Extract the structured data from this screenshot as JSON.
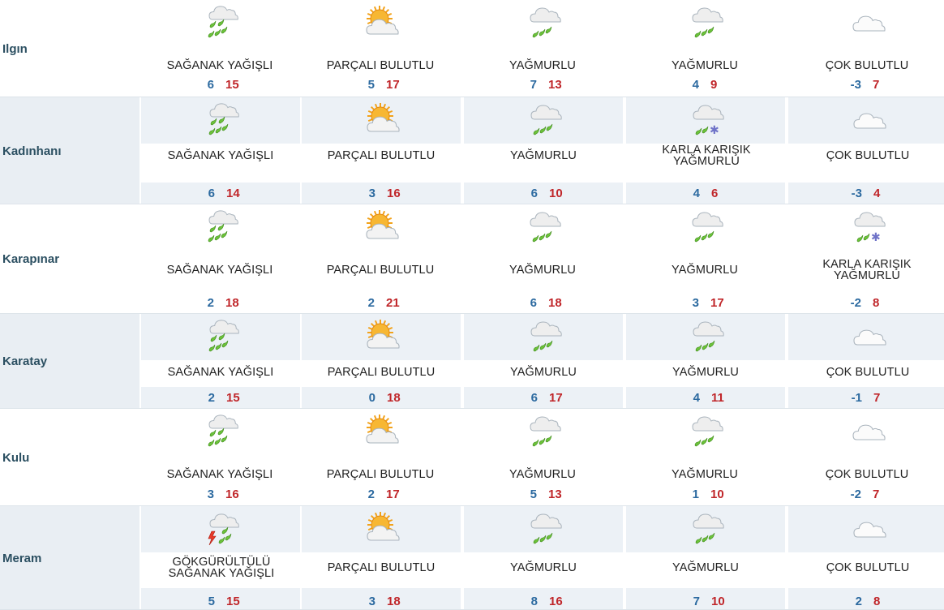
{
  "colors": {
    "min_temp": "#2c6aa0",
    "max_temp": "#c0262a",
    "city": "#2b4f61",
    "alt_row_bg": "#ecf1f6"
  },
  "rows": [
    {
      "city": "Ilgın",
      "days": [
        {
          "icon": "heavy-rain-icon",
          "cond": "SAĞANAK YAĞIŞLI",
          "min": "6",
          "max": "15"
        },
        {
          "icon": "partly-cloudy-icon",
          "cond": "PARÇALI BULUTLU",
          "min": "5",
          "max": "17"
        },
        {
          "icon": "rain-icon",
          "cond": "YAĞMURLU",
          "min": "7",
          "max": "13"
        },
        {
          "icon": "rain-icon",
          "cond": "YAĞMURLU",
          "min": "4",
          "max": "9"
        },
        {
          "icon": "overcast-icon",
          "cond": "ÇOK BULUTLU",
          "min": "-3",
          "max": "7"
        }
      ]
    },
    {
      "city": "Kadınhanı",
      "days": [
        {
          "icon": "heavy-rain-icon",
          "cond": "SAĞANAK YAĞIŞLI",
          "min": "6",
          "max": "14"
        },
        {
          "icon": "partly-cloudy-icon",
          "cond": "PARÇALI BULUTLU",
          "min": "3",
          "max": "16"
        },
        {
          "icon": "rain-icon",
          "cond": "YAĞMURLU",
          "min": "6",
          "max": "10"
        },
        {
          "icon": "sleet-icon",
          "cond": "KARLA KARIŞIK YAĞMURLU",
          "min": "4",
          "max": "6"
        },
        {
          "icon": "overcast-icon",
          "cond": "ÇOK BULUTLU",
          "min": "-3",
          "max": "4"
        }
      ]
    },
    {
      "city": "Karapınar",
      "days": [
        {
          "icon": "heavy-rain-icon",
          "cond": "SAĞANAK YAĞIŞLI",
          "min": "2",
          "max": "18"
        },
        {
          "icon": "partly-cloudy-icon",
          "cond": "PARÇALI BULUTLU",
          "min": "2",
          "max": "21"
        },
        {
          "icon": "rain-icon",
          "cond": "YAĞMURLU",
          "min": "6",
          "max": "18"
        },
        {
          "icon": "rain-icon",
          "cond": "YAĞMURLU",
          "min": "3",
          "max": "17"
        },
        {
          "icon": "sleet-icon",
          "cond": "KARLA KARIŞIK YAĞMURLU",
          "min": "-2",
          "max": "8"
        }
      ]
    },
    {
      "city": "Karatay",
      "days": [
        {
          "icon": "heavy-rain-icon",
          "cond": "SAĞANAK YAĞIŞLI",
          "min": "2",
          "max": "15"
        },
        {
          "icon": "partly-cloudy-icon",
          "cond": "PARÇALI BULUTLU",
          "min": "0",
          "max": "18"
        },
        {
          "icon": "rain-icon",
          "cond": "YAĞMURLU",
          "min": "6",
          "max": "17"
        },
        {
          "icon": "rain-icon",
          "cond": "YAĞMURLU",
          "min": "4",
          "max": "11"
        },
        {
          "icon": "overcast-icon",
          "cond": "ÇOK BULUTLU",
          "min": "-1",
          "max": "7"
        }
      ]
    },
    {
      "city": "Kulu",
      "days": [
        {
          "icon": "heavy-rain-icon",
          "cond": "SAĞANAK YAĞIŞLI",
          "min": "3",
          "max": "16"
        },
        {
          "icon": "partly-cloudy-icon",
          "cond": "PARÇALI BULUTLU",
          "min": "2",
          "max": "17"
        },
        {
          "icon": "rain-icon",
          "cond": "YAĞMURLU",
          "min": "5",
          "max": "13"
        },
        {
          "icon": "rain-icon",
          "cond": "YAĞMURLU",
          "min": "1",
          "max": "10"
        },
        {
          "icon": "overcast-icon",
          "cond": "ÇOK BULUTLU",
          "min": "-2",
          "max": "7"
        }
      ]
    },
    {
      "city": "Meram",
      "days": [
        {
          "icon": "thunderstorm-icon",
          "cond": "GÖKGÜRÜLTÜLÜ SAĞANAK YAĞIŞLI",
          "min": "5",
          "max": "15"
        },
        {
          "icon": "partly-cloudy-icon",
          "cond": "PARÇALI BULUTLU",
          "min": "3",
          "max": "18"
        },
        {
          "icon": "rain-icon",
          "cond": "YAĞMURLU",
          "min": "8",
          "max": "16"
        },
        {
          "icon": "rain-icon",
          "cond": "YAĞMURLU",
          "min": "7",
          "max": "10"
        },
        {
          "icon": "overcast-icon",
          "cond": "ÇOK BULUTLU",
          "min": "2",
          "max": "8"
        }
      ]
    }
  ]
}
